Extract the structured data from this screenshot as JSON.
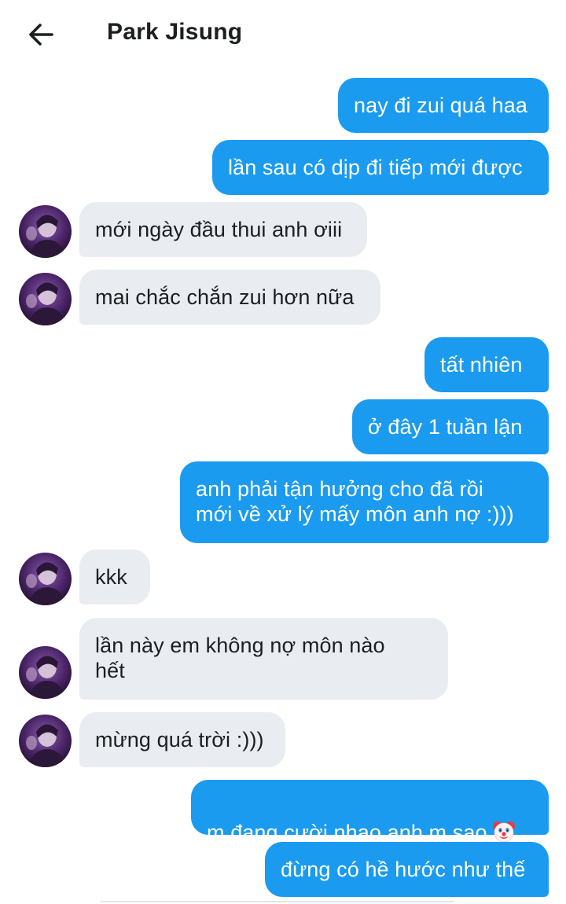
{
  "header": {
    "title": "Park Jisung",
    "back_icon": "arrow-left-icon"
  },
  "contact": {
    "avatar_icon": "contact-avatar-photo"
  },
  "messages": [
    {
      "side": "out",
      "text": "nay đi zui quá haa"
    },
    {
      "side": "out",
      "text": "lần sau có dịp đi tiếp mới được"
    },
    {
      "side": "in",
      "text": "mới ngày đầu thui anh ơiii"
    },
    {
      "side": "in",
      "text": "mai chắc chắn zui hơn nữa"
    },
    {
      "side": "out",
      "text": "tất nhiên"
    },
    {
      "side": "out",
      "text": "ở đây 1 tuần lận"
    },
    {
      "side": "out",
      "text": "anh phải tận hưởng cho đã rồi\nmới về xử lý mấy môn anh nợ :)))"
    },
    {
      "side": "in",
      "text": "kkk"
    },
    {
      "side": "in",
      "text": "lần này em không nợ môn nào\nhết"
    },
    {
      "side": "in",
      "text": "mừng quá trời :)))"
    },
    {
      "side": "out",
      "text": "m đang cười nhạo anh m sao",
      "emoji": "clown-face-emoji"
    },
    {
      "side": "out",
      "text": "đừng có hề hước như thế"
    }
  ],
  "colors": {
    "outgoing_bubble": "#1a9bf0",
    "incoming_bubble": "#e9edf1",
    "outgoing_text": "#ffffff",
    "incoming_text": "#1c1e21"
  }
}
